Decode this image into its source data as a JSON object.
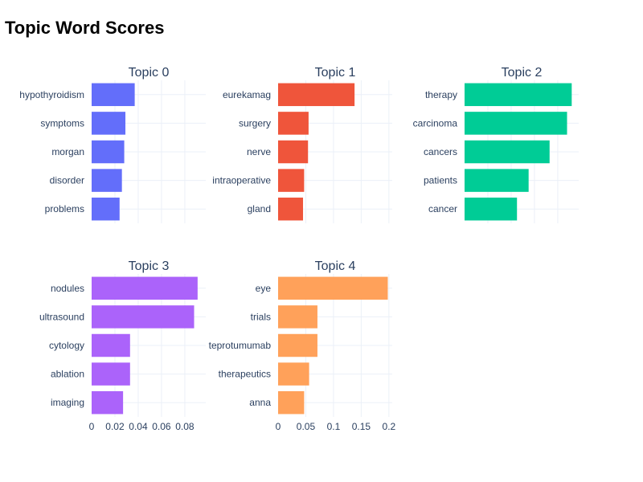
{
  "title": "Topic Word Scores",
  "chart_data": [
    {
      "type": "bar",
      "orientation": "horizontal",
      "title": "Topic 0",
      "color": "#636efa",
      "categories": [
        "hypothyroidism",
        "symptoms",
        "morgan",
        "disorder",
        "problems"
      ],
      "values": [
        0.037,
        0.029,
        0.028,
        0.026,
        0.024
      ],
      "xlim": [
        0,
        0.098
      ],
      "xticks": [
        0,
        0.02,
        0.04,
        0.06,
        0.08
      ],
      "xtick_labels": [
        "0",
        "0.02",
        "0.04",
        "0.06",
        "0.08"
      ],
      "show_xtick_labels": false
    },
    {
      "type": "bar",
      "orientation": "horizontal",
      "title": "Topic 1",
      "color": "#ef553b",
      "categories": [
        "eurekamag",
        "surgery",
        "nerve",
        "intraoperative",
        "gland"
      ],
      "values": [
        0.138,
        0.055,
        0.054,
        0.047,
        0.045
      ],
      "xlim": [
        0,
        0.206
      ],
      "xticks": [
        0,
        0.05,
        0.1,
        0.15,
        0.2
      ],
      "xtick_labels": [
        "0",
        "0.05",
        "0.1",
        "0.15",
        "0.2"
      ],
      "show_xtick_labels": false
    },
    {
      "type": "bar",
      "orientation": "horizontal",
      "title": "Topic 2",
      "color": "#00cc96",
      "categories": [
        "therapy",
        "carcinoma",
        "cancers",
        "patients",
        "cancer"
      ],
      "values": [
        0.092,
        0.088,
        0.073,
        0.055,
        0.045
      ],
      "xlim": [
        0,
        0.098
      ],
      "xticks": [
        0,
        0.02,
        0.04,
        0.06,
        0.08
      ],
      "xtick_labels": [
        "0",
        "0.02",
        "0.04",
        "0.06",
        "0.08"
      ],
      "show_xtick_labels": false
    },
    {
      "type": "bar",
      "orientation": "horizontal",
      "title": "Topic 3",
      "color": "#ab63fa",
      "categories": [
        "nodules",
        "ultrasound",
        "cytology",
        "ablation",
        "imaging"
      ],
      "values": [
        0.091,
        0.088,
        0.033,
        0.033,
        0.027
      ],
      "xlim": [
        0,
        0.098
      ],
      "xticks": [
        0,
        0.02,
        0.04,
        0.06,
        0.08
      ],
      "xtick_labels": [
        "0",
        "0.02",
        "0.04",
        "0.06",
        "0.08"
      ],
      "show_xtick_labels": true
    },
    {
      "type": "bar",
      "orientation": "horizontal",
      "title": "Topic 4",
      "color": "#ffa15a",
      "categories": [
        "eye",
        "trials",
        "teprotumumab",
        "therapeutics",
        "anna"
      ],
      "values": [
        0.198,
        0.071,
        0.071,
        0.056,
        0.047
      ],
      "xlim": [
        0,
        0.206
      ],
      "xticks": [
        0,
        0.05,
        0.1,
        0.15,
        0.2
      ],
      "xtick_labels": [
        "0",
        "0.05",
        "0.1",
        "0.15",
        "0.2"
      ],
      "show_xtick_labels": true
    }
  ]
}
